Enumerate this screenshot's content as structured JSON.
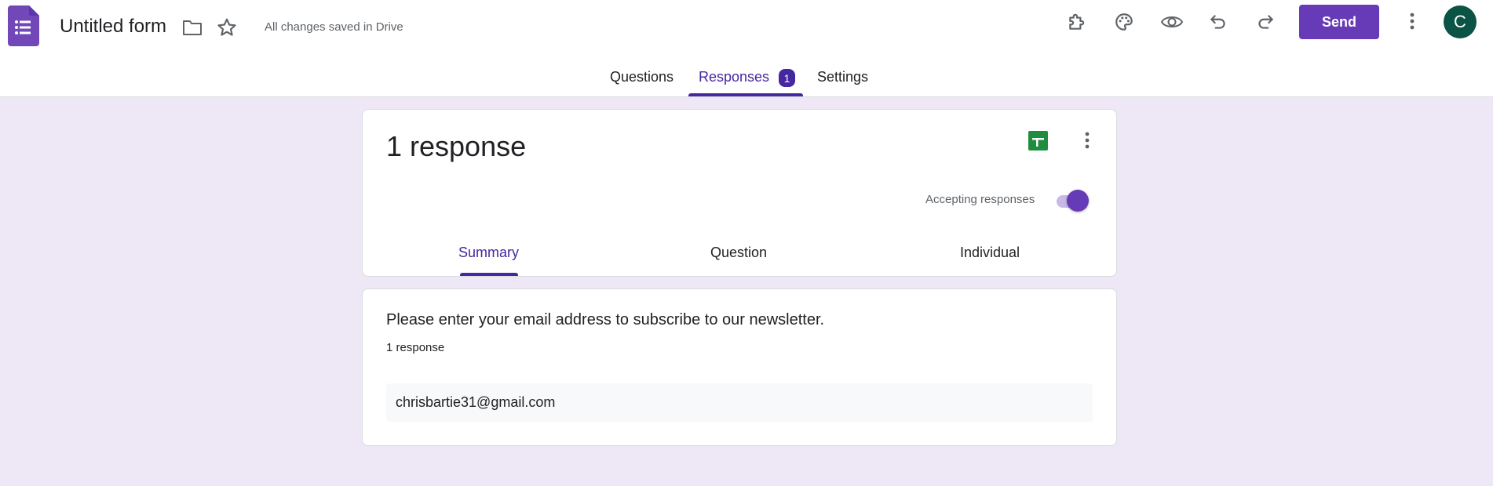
{
  "app": {
    "title": "Untitled form",
    "save_status": "All changes saved in Drive",
    "send_label": "Send",
    "avatar_initial": "C",
    "accent_color": "#673ab7",
    "background_color": "#ede7f6"
  },
  "header_icons": [
    "forms-logo-icon",
    "folder-icon",
    "star-icon",
    "addon-puzzle-icon",
    "palette-icon",
    "preview-eye-icon",
    "undo-icon",
    "redo-icon",
    "more-vert-icon"
  ],
  "tabs": {
    "questions": "Questions",
    "responses": "Responses",
    "responses_badge": "1",
    "settings": "Settings",
    "active": "Responses"
  },
  "summary_card": {
    "response_count": "1 response",
    "accepting_label": "Accepting responses",
    "accepting": true,
    "subtabs": {
      "summary": "Summary",
      "question": "Question",
      "individual": "Individual",
      "active": "Summary"
    }
  },
  "question_card": {
    "title": "Please enter your email address to subscribe to our newsletter.",
    "count": "1 response",
    "answers": [
      "chrisbartie31@gmail.com"
    ]
  }
}
